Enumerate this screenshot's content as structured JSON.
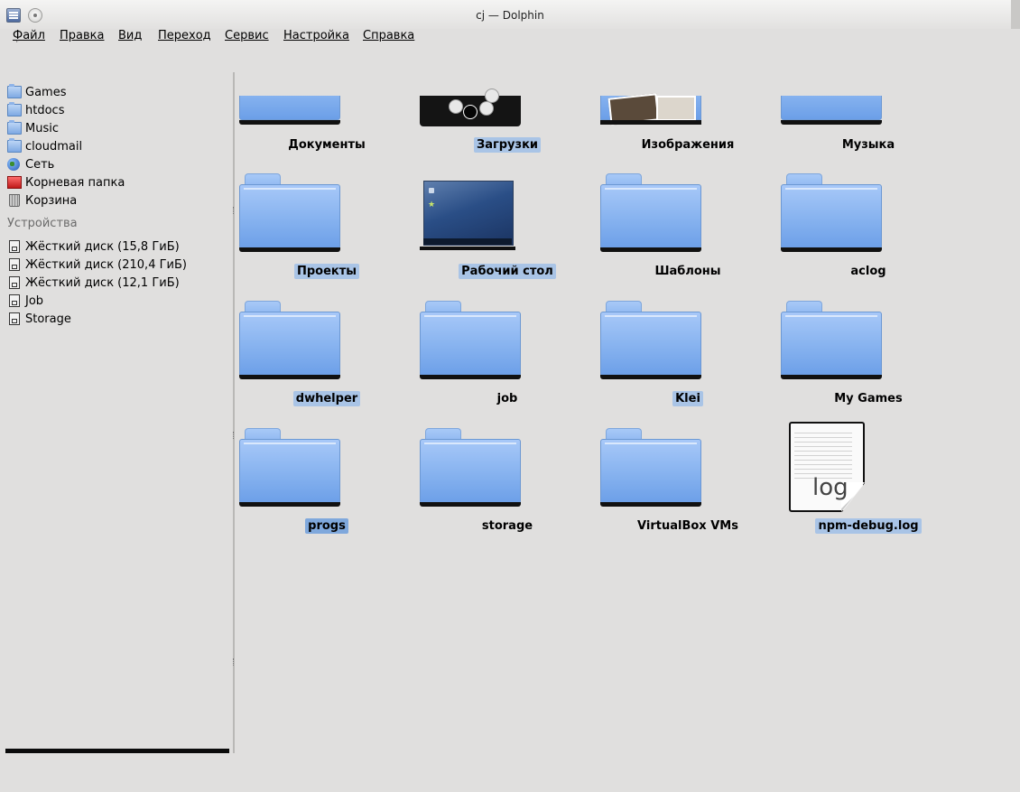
{
  "window": {
    "title": "cj — Dolphin"
  },
  "menu": {
    "items": [
      {
        "label": "Файл"
      },
      {
        "label": "Правка"
      },
      {
        "label": "Вид"
      },
      {
        "label": "Переход"
      },
      {
        "label": "Сервис"
      },
      {
        "label": "Настройка"
      },
      {
        "label": "Справка"
      }
    ]
  },
  "sidebar": {
    "places": [
      {
        "label": "Games",
        "icon": "folder-icon"
      },
      {
        "label": "htdocs",
        "icon": "folder-icon"
      },
      {
        "label": "Music",
        "icon": "folder-icon"
      },
      {
        "label": "cloudmail",
        "icon": "folder-icon"
      },
      {
        "label": "Сеть",
        "icon": "network-globe-icon"
      },
      {
        "label": "Корневая папка",
        "icon": "root-folder-icon"
      },
      {
        "label": "Корзина",
        "icon": "trash-icon"
      }
    ],
    "devices_title": "Устройства",
    "devices": [
      {
        "label": "Жёсткий диск (15,8 ГиБ)",
        "icon": "hard-drive-icon"
      },
      {
        "label": "Жёсткий диск (210,4 ГиБ)",
        "icon": "hard-drive-icon"
      },
      {
        "label": "Жёсткий диск (12,1 ГиБ)",
        "icon": "hard-drive-icon"
      },
      {
        "label": "Job",
        "icon": "hard-drive-icon"
      },
      {
        "label": "Storage",
        "icon": "hard-drive-icon"
      }
    ]
  },
  "files": [
    {
      "name": "Документы",
      "icon": "documents-folder-icon",
      "selected": false
    },
    {
      "name": "Загрузки",
      "icon": "downloads-folder-icon",
      "selected": true
    },
    {
      "name": "Изображения",
      "icon": "pictures-folder-icon",
      "selected": false
    },
    {
      "name": "Музыка",
      "icon": "music-folder-icon",
      "selected": false
    },
    {
      "name": "Проекты",
      "icon": "folder-icon",
      "selected": true
    },
    {
      "name": "Рабочий стол",
      "icon": "desktop-icon",
      "selected": true
    },
    {
      "name": "Шаблоны",
      "icon": "folder-icon",
      "selected": false
    },
    {
      "name": "aclog",
      "icon": "folder-icon",
      "selected": false
    },
    {
      "name": "dwhelper",
      "icon": "folder-icon",
      "selected": true
    },
    {
      "name": "job",
      "icon": "folder-icon",
      "selected": false
    },
    {
      "name": "Klei",
      "icon": "folder-icon",
      "selected": true
    },
    {
      "name": "My Games",
      "icon": "folder-icon",
      "selected": false
    },
    {
      "name": "progs",
      "icon": "folder-icon",
      "selected": true
    },
    {
      "name": "storage",
      "icon": "folder-icon",
      "selected": false
    },
    {
      "name": "VirtualBox VMs",
      "icon": "folder-icon",
      "selected": false
    },
    {
      "name": "npm-debug.log",
      "icon": "log-file-icon",
      "selected": true,
      "icon_text": "log"
    }
  ]
}
